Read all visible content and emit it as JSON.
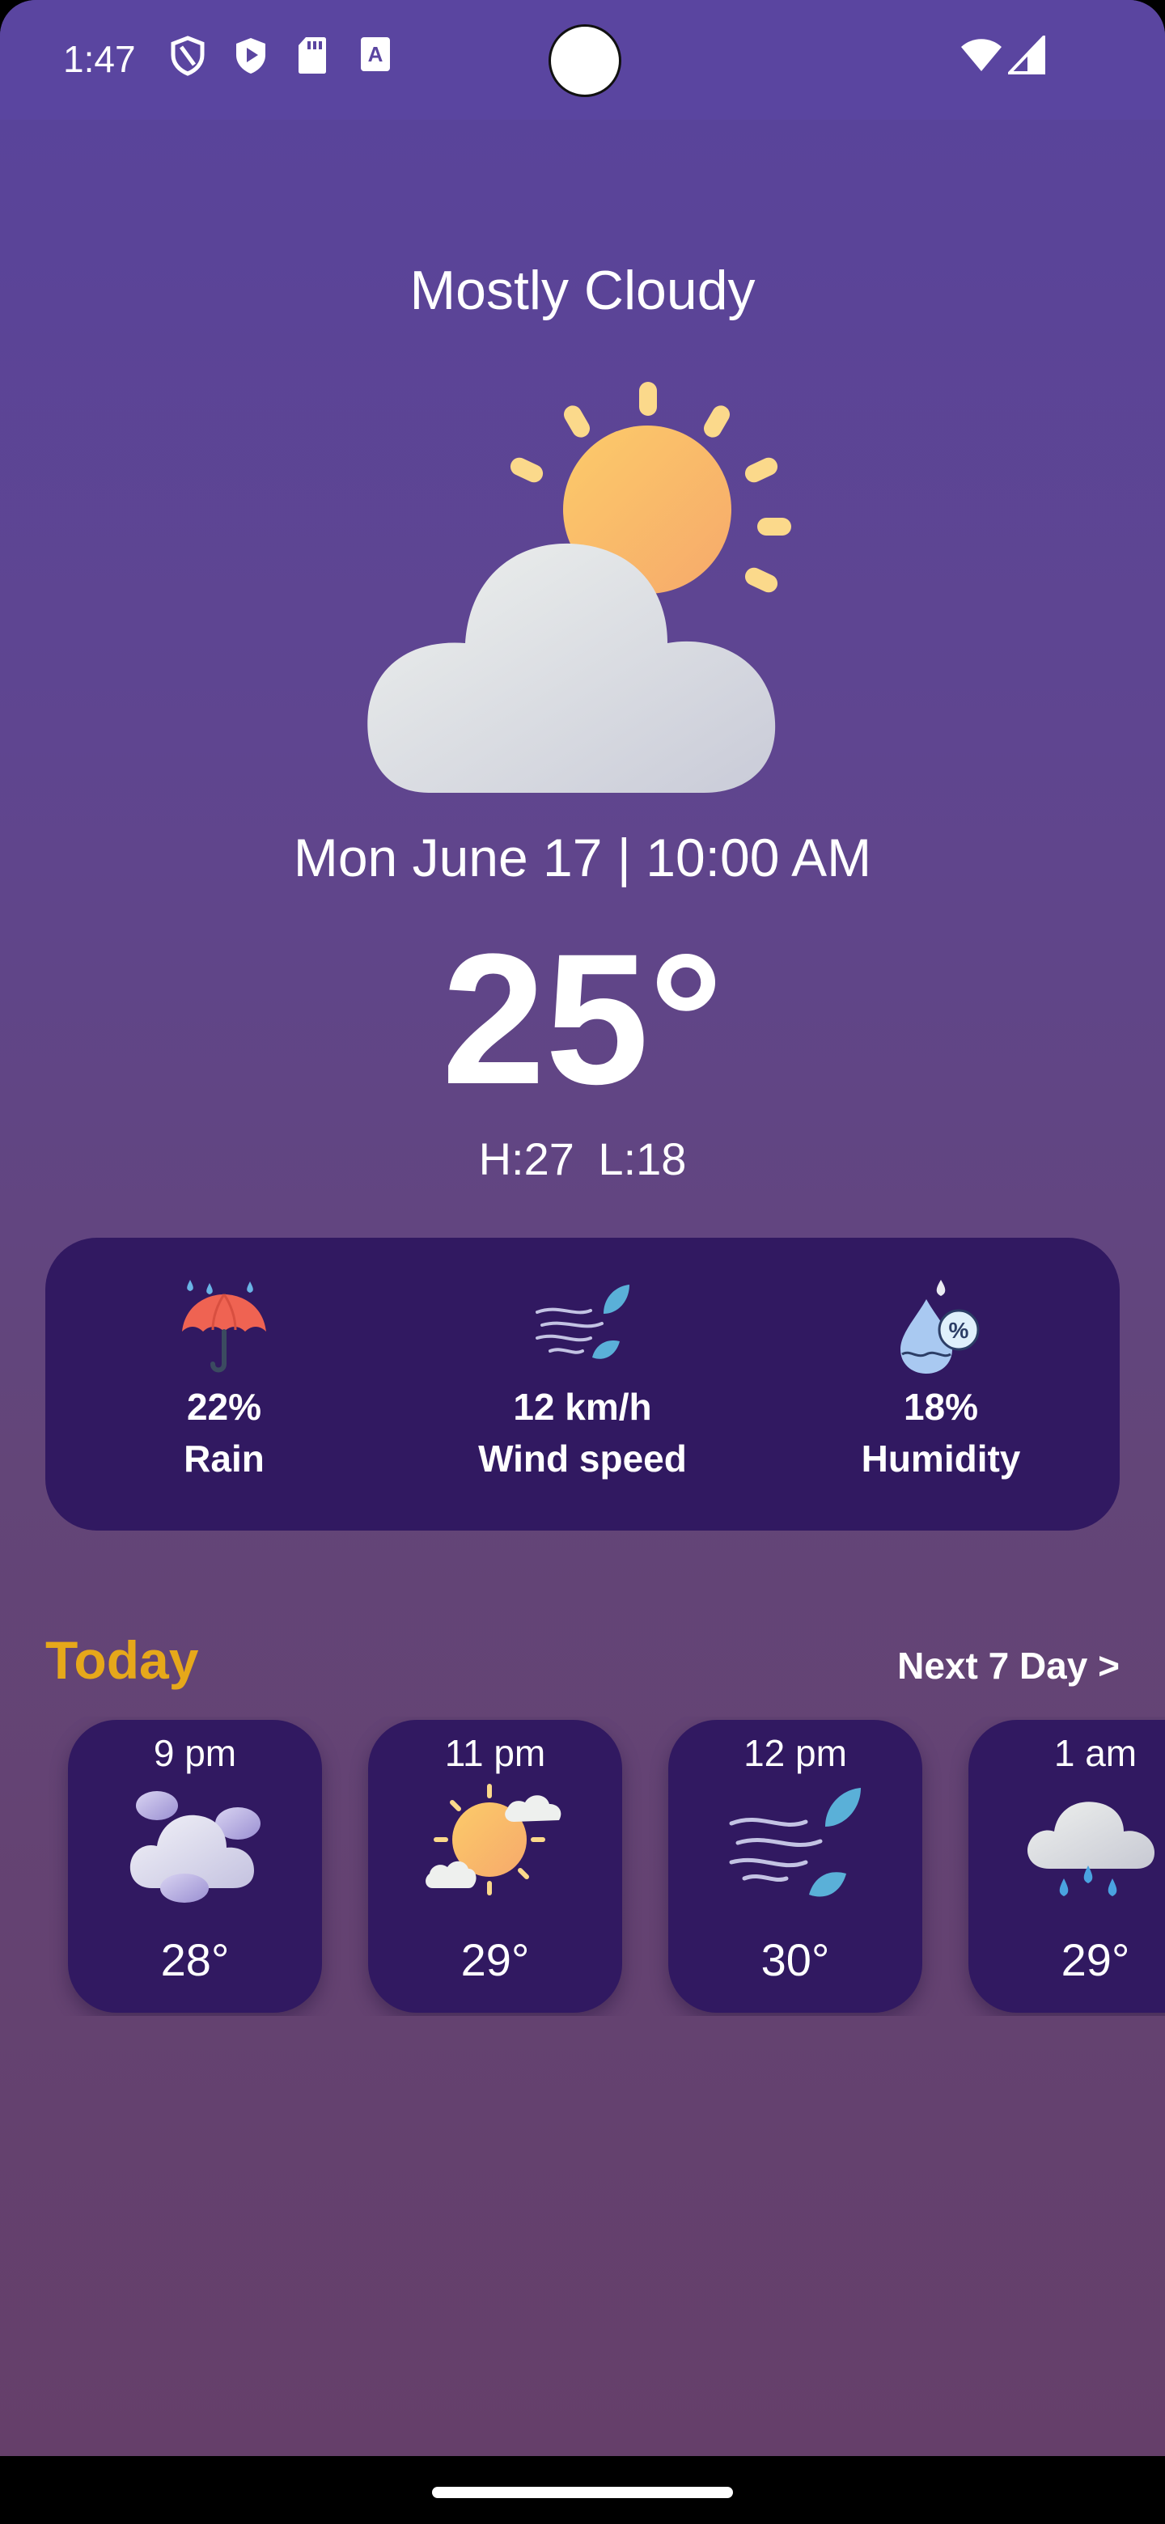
{
  "status_bar": {
    "time": "1:47",
    "icons": [
      "shield-outline-icon",
      "shield-play-icon",
      "sd-card-icon",
      "text-box-icon",
      "wifi-icon",
      "cellular-signal-icon"
    ]
  },
  "weather": {
    "condition": "Mostly Cloudy",
    "hero_icon": "cloud-sun-icon",
    "datetime": "Mon June 17 | 10:00 AM",
    "temperature": "25°",
    "high_low": "H:27 L:18"
  },
  "stats": [
    {
      "value": "22%",
      "label": "Rain",
      "icon": "umbrella-rain-icon"
    },
    {
      "value": "12 km/h",
      "label": "Wind speed",
      "icon": "wind-leaves-icon"
    },
    {
      "value": "18%",
      "label": "Humidity",
      "icon": "humidity-drop-icon"
    }
  ],
  "today": {
    "heading": "Today",
    "next_link": "Next 7 Day >"
  },
  "hourly": [
    {
      "time": "9 pm",
      "temp": "28°",
      "icon": "clouds-icon"
    },
    {
      "time": "11 pm",
      "temp": "29°",
      "icon": "sun-cloud-icon"
    },
    {
      "time": "12 pm",
      "temp": "30°",
      "icon": "wind-leaves-icon"
    },
    {
      "time": "1 am",
      "temp": "29°",
      "icon": "rain-cloud-icon"
    }
  ],
  "colors": {
    "accent_today": "#e6a81a",
    "card_bg": "#311961",
    "status_bar": "#5a45a0"
  }
}
